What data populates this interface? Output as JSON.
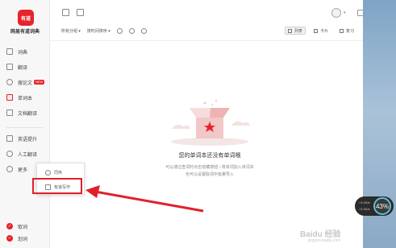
{
  "app": {
    "logo_text": "有道",
    "name": "网易有道词典"
  },
  "sidebar": {
    "items": [
      {
        "label": "词典"
      },
      {
        "label": "翻译"
      },
      {
        "label": "搜论文",
        "badge": "NEW"
      },
      {
        "label": "单词本"
      },
      {
        "label": "文档翻译"
      },
      {
        "label": "英语提升"
      },
      {
        "label": "人工翻译"
      },
      {
        "label": "更多"
      }
    ],
    "bottom": [
      {
        "label": "取词"
      },
      {
        "label": "划词"
      }
    ]
  },
  "toolbar": {
    "filters": [
      "所有分组 ▾",
      "按时间排序 ▾"
    ],
    "views": [
      {
        "label": "列表"
      },
      {
        "label": "卡片"
      },
      {
        "label": "复习"
      }
    ]
  },
  "empty_state": {
    "title": "您的单词本还没有单词哦",
    "line1": "可以通过查词时点击收藏按钮☆将单词加入单词本",
    "line2": "也可以设置取词中批量导入"
  },
  "popup": {
    "items": [
      {
        "label": "同传"
      },
      {
        "label": "有道写作"
      }
    ]
  },
  "desktop": {
    "speed_percent": "43%",
    "speed_up": "↑ 0.1K/s",
    "speed_down": "↓ 0.1K/s",
    "watermark": "Baidu 经验",
    "watermark_sub": "jingyan.baidu.com"
  },
  "colors": {
    "accent": "#e6242a",
    "highlight": "#e0202a"
  }
}
